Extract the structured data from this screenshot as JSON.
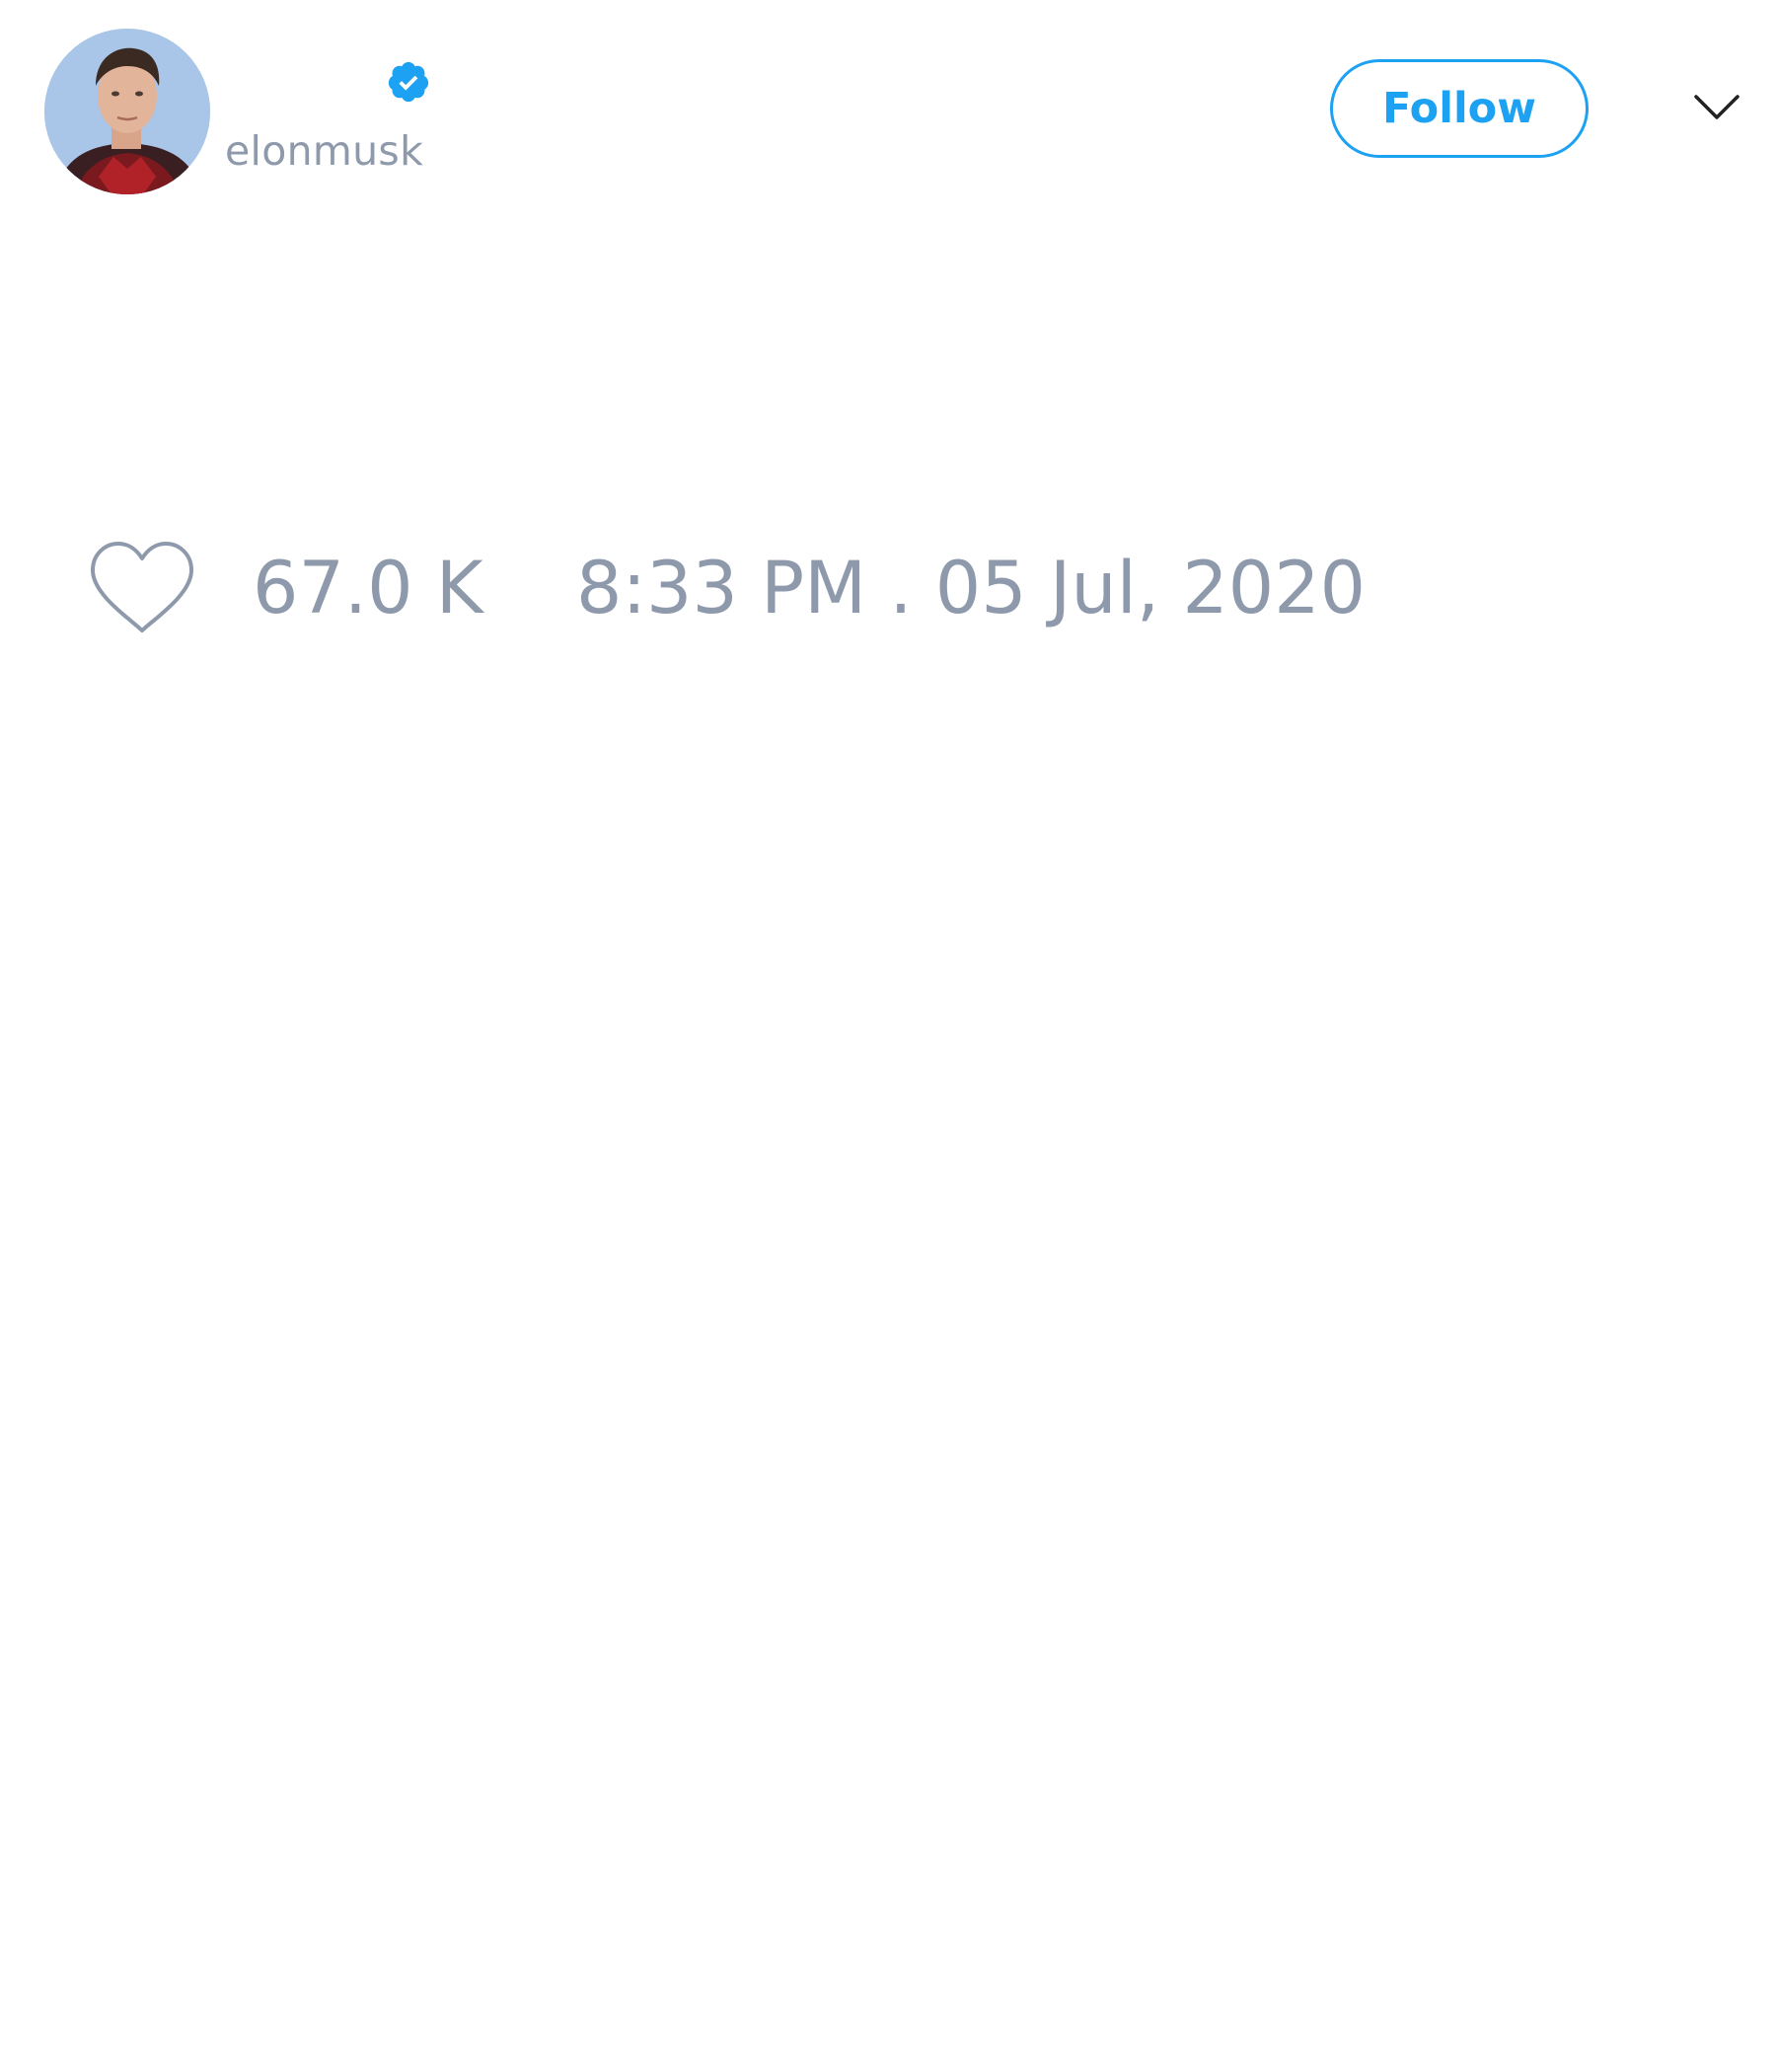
{
  "tweet": {
    "author": {
      "handle": "elonmusk",
      "verified": true,
      "avatar_icon": "profile-photo"
    },
    "follow_label": "Follow",
    "menu_icon": "chevron-down-icon",
    "like_icon": "heart-icon",
    "like_count": "67.0 K",
    "timestamp": "8:33 PM . 05 Jul, 2020"
  },
  "colors": {
    "accent": "#1da1f2",
    "muted_text": "#8e9aab",
    "background": "#ffffff"
  }
}
